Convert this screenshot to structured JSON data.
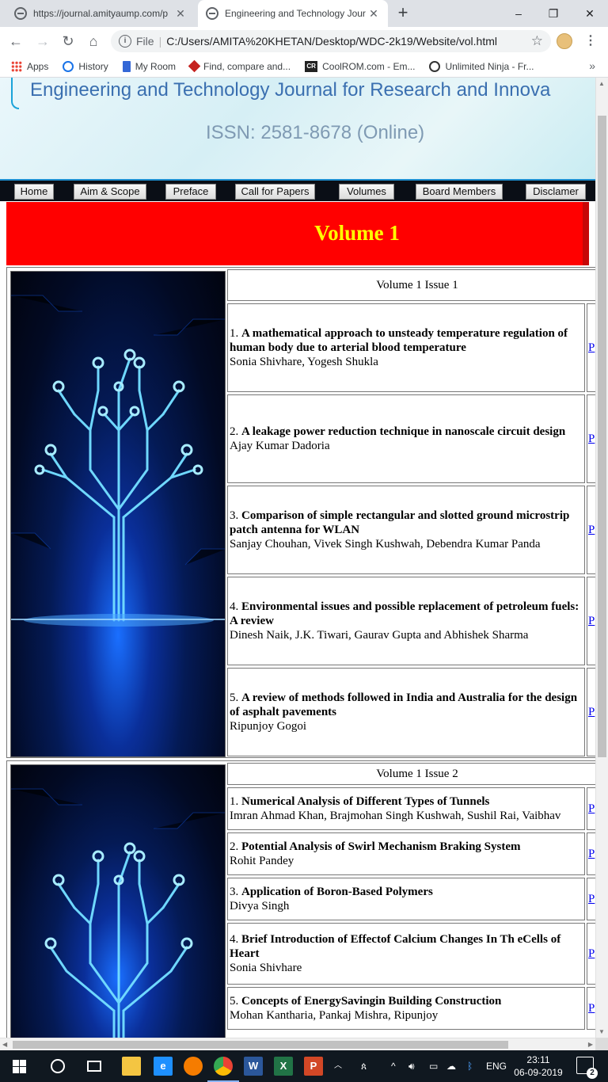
{
  "browser": {
    "tabs": [
      {
        "title": "https://journal.amityaump.com/p",
        "active": false
      },
      {
        "title": "Engineering and Technology Jour",
        "active": true
      }
    ],
    "new_tab": "+",
    "window_controls": {
      "minimize": "–",
      "restore": "❐",
      "close": "✕"
    },
    "nav": {
      "back": "←",
      "forward": "→",
      "reload": "↻",
      "home": "⌂"
    },
    "address": {
      "scheme_label": "File",
      "url": "C:/Users/AMITA%20KHETAN/Desktop/WDC-2k19/Website/vol.html"
    },
    "bookmarks": [
      {
        "label": "Apps",
        "icon": "apps-grid-icon"
      },
      {
        "label": "History",
        "icon": "history-icon"
      },
      {
        "label": "My Room",
        "icon": "book-icon"
      },
      {
        "label": "Find, compare and...",
        "icon": "diamond-icon"
      },
      {
        "label": "CoolROM.com - Em...",
        "icon": "coolrom-icon"
      },
      {
        "label": "Unlimited Ninja - Fr...",
        "icon": "globe-icon"
      }
    ],
    "bookmarks_more": "»"
  },
  "page": {
    "banner_title": "Engineering and Technology Journal for Research and Innova",
    "issn": "ISSN: 2581-8678 (Online)",
    "nav": [
      "Home",
      "Aim & Scope",
      "Preface",
      "Call for Papers",
      "Volumes",
      "Board Members",
      "Disclamer"
    ],
    "volume_title": "Volume 1",
    "issues": [
      {
        "heading": "Volume 1 Issue 1",
        "papers": [
          {
            "num": "1.",
            "title": "A mathematical approach to unsteady temperature regulation of human body due to arterial blood temperature",
            "authors": "Sonia Shivhare, Yogesh Shukla",
            "link": "P"
          },
          {
            "num": "2.",
            "title": "A leakage power reduction technique in nanoscale circuit design",
            "authors": "Ajay Kumar Dadoria",
            "link": "P"
          },
          {
            "num": "3.",
            "title": "Comparison of simple rectangular and slotted ground microstrip patch antenna for WLAN",
            "authors": "Sanjay Chouhan, Vivek Singh Kushwah, Debendra Kumar Panda",
            "link": "P"
          },
          {
            "num": "4.",
            "title": "Environmental issues and possible replacement of petroleum fuels: A review",
            "authors": "Dinesh Naik, J.K. Tiwari, Gaurav Gupta and Abhishek Sharma",
            "link": "P"
          },
          {
            "num": "5.",
            "title": "A review of methods followed in India and Australia for the design of asphalt pavements",
            "authors": "Ripunjoy Gogoi",
            "link": "P"
          }
        ]
      },
      {
        "heading": "Volume 1 Issue 2",
        "papers": [
          {
            "num": "1.",
            "title": "Numerical Analysis of Different Types of Tunnels",
            "authors": "Imran Ahmad Khan, Brajmohan Singh Kushwah, Sushil Rai, Vaibhav",
            "link": "P"
          },
          {
            "num": "2.",
            "title": "Potential Analysis of Swirl Mechanism Braking System",
            "authors": "Rohit Pandey",
            "link": "P"
          },
          {
            "num": "3.",
            "title": "Application of Boron-Based Polymers",
            "authors": "Divya Singh",
            "link": "P"
          },
          {
            "num": "4.",
            "title": "Brief Introduction of Effectof Calcium Changes In Th eCells of Heart",
            "authors": "Sonia Shivhare",
            "link": "P"
          },
          {
            "num": "5.",
            "title": "Concepts of EnergySavingin Building Construction",
            "authors": "Mohan Kantharia, Pankaj Mishra, Ripunjoy",
            "link": "P"
          }
        ]
      }
    ]
  },
  "taskbar": {
    "apps": [
      {
        "name": "file-explorer",
        "label": "",
        "color": "#f4c542"
      },
      {
        "name": "edge",
        "label": "e",
        "color": "#1e90ff"
      },
      {
        "name": "avast",
        "label": "",
        "color": "#f57c00"
      },
      {
        "name": "chrome",
        "label": "",
        "color": "#34a853"
      },
      {
        "name": "word",
        "label": "W",
        "color": "#2b579a"
      },
      {
        "name": "excel",
        "label": "X",
        "color": "#217346"
      },
      {
        "name": "powerpoint",
        "label": "P",
        "color": "#d24726"
      }
    ],
    "language": "ENG",
    "time": "23:11",
    "date": "06-09-2019",
    "notifications": "2"
  }
}
